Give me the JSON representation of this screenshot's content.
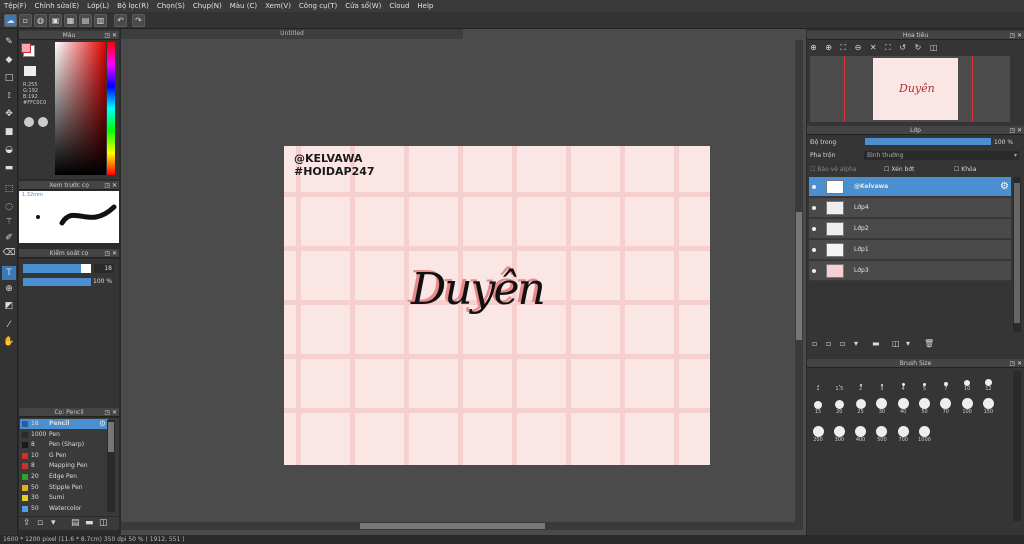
{
  "menu": [
    "Tệp(F)",
    "Chỉnh sửa(E)",
    "Lớp(L)",
    "Bộ lọc(R)",
    "Chọn(S)",
    "Chụp(N)",
    "Màu (C)",
    "Xem(V)",
    "Công cụ(T)",
    "Cửa sổ(W)",
    "Cloud",
    "Help"
  ],
  "panels": {
    "color": "Màu",
    "brush_preview": "Xem trước cọ",
    "brush_control": "Kiểm soát cọ",
    "brush_list": "Cọ: Pencil",
    "navigator": "Hoa tiêu",
    "layer": "Lớp",
    "brush_size": "Brush Size"
  },
  "color": {
    "r": "R:255",
    "g": "G:192",
    "b": "B:192",
    "hex": "#FFC0C0",
    "fg": "#f4a9b0",
    "bg": "#ffffff"
  },
  "brush_preview": {
    "size": "1.32mm"
  },
  "brush_control": {
    "size_value": "18",
    "opacity_value": "100 %",
    "size_fill": 0.85,
    "opacity_fill": 1.0
  },
  "brushes": [
    {
      "size": "18",
      "name": "Pencil",
      "color": "#2a5d9b",
      "selected": true
    },
    {
      "size": "1000",
      "name": "Pen",
      "color": "#2a2a2a"
    },
    {
      "size": "8",
      "name": "Pen (Sharp)",
      "color": "#1a1a1a"
    },
    {
      "size": "10",
      "name": "G Pen",
      "color": "#d03030"
    },
    {
      "size": "8",
      "name": "Mapping Pen",
      "color": "#d03030"
    },
    {
      "size": "20",
      "name": "Edge Pen",
      "color": "#30a030"
    },
    {
      "size": "50",
      "name": "Stipple Pen",
      "color": "#e0b020"
    },
    {
      "size": "30",
      "name": "Sumi",
      "color": "#e0d020"
    },
    {
      "size": "50",
      "name": "Watercolor",
      "color": "#4aa0e0"
    }
  ],
  "document": {
    "tab": "Untitled",
    "line1": "@KELVAWA",
    "line2": "#HOIDAP247",
    "signature": "Duyên"
  },
  "layer": {
    "opacity_label": "Độ trong",
    "opacity_value": "100 %",
    "blend_label": "Pha trộn",
    "blend_value": "Bình thường",
    "protect_alpha": "Bảo vệ alpha",
    "clipping": "Xén bớt",
    "lock": "Khóa",
    "layers": [
      "@Kelvawa",
      "Lớp4",
      "Lớp2",
      "Lớp1",
      "Lớp3"
    ]
  },
  "brush_sizes": [
    "1",
    "1.5",
    "2",
    "3",
    "4",
    "5",
    "7",
    "10",
    "12",
    "15",
    "20",
    "25",
    "30",
    "40",
    "50",
    "70",
    "100",
    "150",
    "200",
    "300",
    "400",
    "500",
    "700",
    "1000"
  ],
  "status": "1600 * 1200 pixel  (11.6 * 8.7cm)  350 dpi  50 %  ( 1912, 551 )"
}
